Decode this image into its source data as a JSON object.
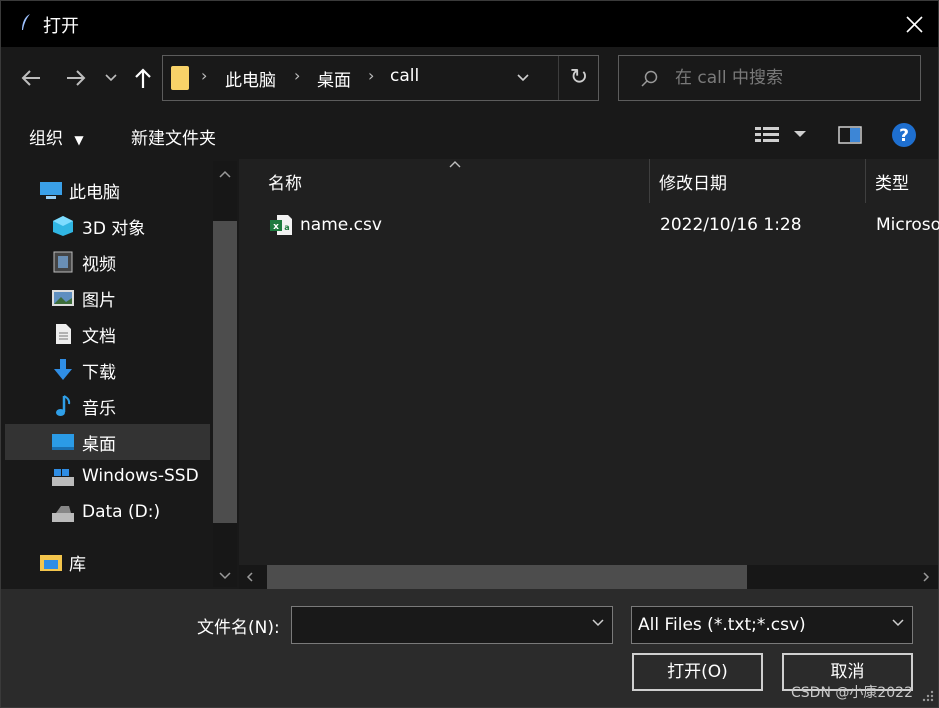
{
  "window": {
    "title": "打开",
    "close_icon": "close-icon"
  },
  "nav": {
    "back_icon": "arrow-left-icon",
    "forward_icon": "arrow-right-icon",
    "recent_icon": "chevron-down-icon",
    "up_icon": "arrow-up-icon",
    "breadcrumb": [
      "此电脑",
      "桌面",
      "call"
    ],
    "refresh_icon": "refresh-icon",
    "search_placeholder": "在 call 中搜索"
  },
  "toolbar": {
    "organize_label": "组织",
    "new_folder_label": "新建文件夹",
    "view_icon": "view-details-icon",
    "preview_icon": "preview-pane-icon",
    "help_icon": "help-icon"
  },
  "sidebar": {
    "items": [
      {
        "label": "此电脑",
        "icon": "computer-icon"
      },
      {
        "label": "3D 对象",
        "icon": "cube-icon"
      },
      {
        "label": "视频",
        "icon": "video-icon"
      },
      {
        "label": "图片",
        "icon": "picture-icon"
      },
      {
        "label": "文档",
        "icon": "document-icon"
      },
      {
        "label": "下载",
        "icon": "download-icon"
      },
      {
        "label": "音乐",
        "icon": "music-icon"
      },
      {
        "label": "桌面",
        "icon": "desktop-icon",
        "selected": true
      },
      {
        "label": "Windows-SSD",
        "icon": "drive-icon"
      },
      {
        "label": "Data (D:)",
        "icon": "drive-icon"
      },
      {
        "label": "库",
        "icon": "library-icon"
      }
    ]
  },
  "filelist": {
    "columns": [
      "名称",
      "修改日期",
      "类型"
    ],
    "rows": [
      {
        "name": "name.csv",
        "date": "2022/10/16 1:28",
        "type": "Microso",
        "icon": "excel-csv-icon"
      }
    ]
  },
  "bottom": {
    "filename_label": "文件名(N):",
    "filename_value": "",
    "filetype_value": "All Files (*.txt;*.csv)",
    "open_label": "打开(O)",
    "cancel_label": "取消",
    "watermark": "CSDN @小康2022"
  },
  "colors": {
    "background": "#191919",
    "titlebar": "#000000",
    "selected": "#333333",
    "folder": "#f8d268",
    "help": "#1e6fd0"
  }
}
